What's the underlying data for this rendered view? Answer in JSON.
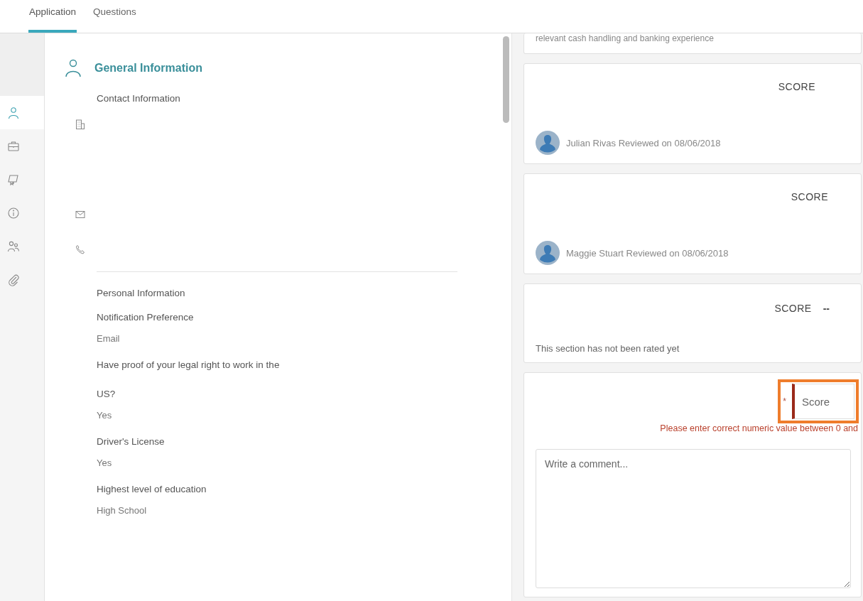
{
  "tabs": [
    {
      "label": "Application",
      "selected": true
    },
    {
      "label": "Questions",
      "selected": false
    }
  ],
  "sidebar": {
    "items": [
      {
        "kind": "person",
        "selected": true
      },
      {
        "kind": "briefcase",
        "selected": false
      },
      {
        "kind": "certificate",
        "selected": false
      },
      {
        "kind": "info",
        "selected": false
      },
      {
        "kind": "people",
        "selected": false
      },
      {
        "kind": "paperclip",
        "selected": false
      }
    ]
  },
  "section": {
    "title": "General Information",
    "contact_heading": "Contact Information",
    "contact_rows": [
      {
        "kind": "building"
      },
      {
        "kind": "mail"
      },
      {
        "kind": "phone"
      }
    ],
    "personal_heading": "Personal Information",
    "fields": [
      {
        "label": "Notification Preference",
        "value": "Email"
      },
      {
        "label": "Have proof of your legal right to work in the US?",
        "value": "Yes"
      },
      {
        "label": "Driver's License",
        "value": "Yes"
      },
      {
        "label": "Highest level of education",
        "value": "High School"
      }
    ]
  },
  "reviews": [
    {
      "kind": "note",
      "text": "relevant cash handling and banking experience"
    },
    {
      "kind": "review",
      "score_label": "SCORE",
      "reviewer": "Julian Rivas Reviewed on 08/06/2018"
    },
    {
      "kind": "review",
      "score_label": "SCORE",
      "reviewer": "Maggie Stuart Reviewed on 08/06/2018"
    },
    {
      "kind": "unrated",
      "score_label": "SCORE",
      "score_value": "--",
      "text": "This section has not been rated yet"
    }
  ],
  "score_form": {
    "required_mark": "*",
    "placeholder": "Score",
    "invalid": true,
    "error": "Please enter correct numeric value between 0 and",
    "comment_placeholder": "Write a comment..."
  }
}
